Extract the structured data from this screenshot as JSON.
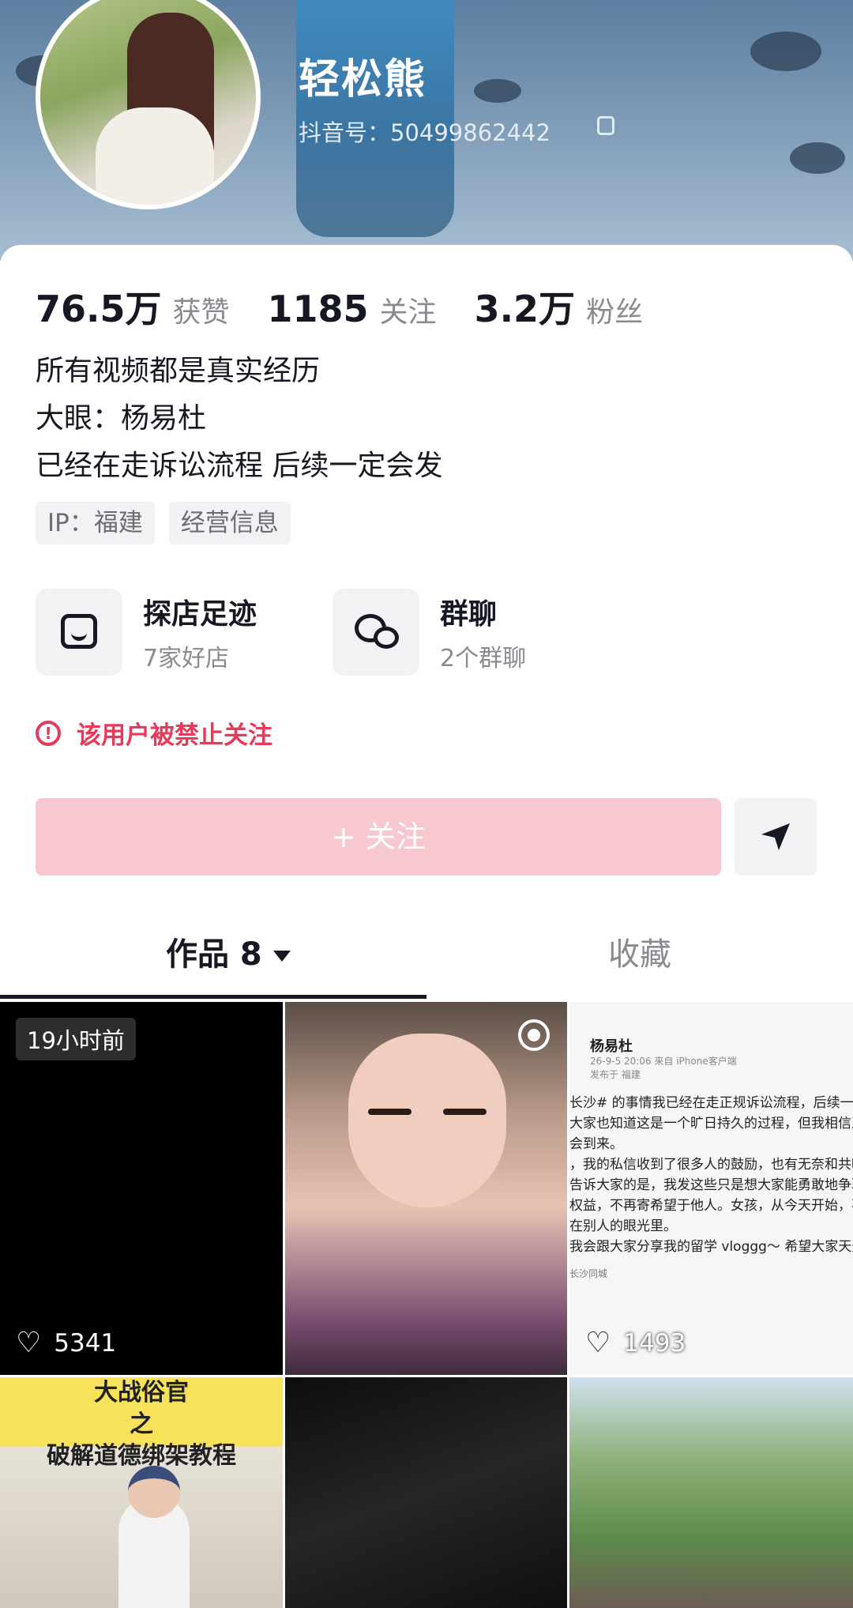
{
  "profile": {
    "nickname": "轻松熊",
    "douyin_id": "抖音号：50499862442",
    "stats": [
      {
        "value": "76.5万",
        "label": "获赞"
      },
      {
        "value": "1185",
        "label": "关注"
      },
      {
        "value": "3.2万",
        "label": "粉丝"
      }
    ],
    "bio": [
      "所有视频都是真实经历",
      "大眼：杨易杜",
      "已经在走诉讼流程 后续一定会发"
    ],
    "tags": [
      "IP：福建",
      "经营信息"
    ]
  },
  "features": [
    {
      "title": "探店足迹",
      "subtitle": "7家好店",
      "icon": "shop-icon"
    },
    {
      "title": "群聊",
      "subtitle": "2个群聊",
      "icon": "chat-icon"
    }
  ],
  "warning": {
    "icon": "!",
    "text": "该用户被禁止关注"
  },
  "actions": {
    "follow_label": "+ 关注",
    "share_icon": "send-icon"
  },
  "tabs": {
    "works_label": "作品 8",
    "favorites_label": "收藏"
  },
  "grid": {
    "items": [
      {
        "time_badge": "19小时前",
        "likes": "5341"
      },
      {
        "likes": ""
      },
      {
        "likes": "1493"
      },
      {
        "title_top": "大战俗官",
        "title_mid": "之",
        "title_bottom": "破解道德绑架教程"
      },
      {},
      {}
    ],
    "post": {
      "name": "杨易杜",
      "meta": "26-9-5 20:06 来自 iPhone客户端",
      "meta2": "发布于 福建",
      "lines": [
        "长沙# 的事情我已经在走正规诉讼流程，后续一定会",
        "大家也知道这是一个旷日持久的过程，但我相信正",
        "会到来。",
        "，我的私信收到了很多人的鼓励，也有无奈和共鸣",
        "告诉大家的是，我发这些只是想大家能勇敢地争取",
        "权益，不再寄希望于他人。女孩，从今天开始，不",
        "在别人的眼光里。",
        "我会跟大家分享我的留学 vloggg～ 希望大家天天"
      ],
      "footer": "长沙同城"
    }
  }
}
